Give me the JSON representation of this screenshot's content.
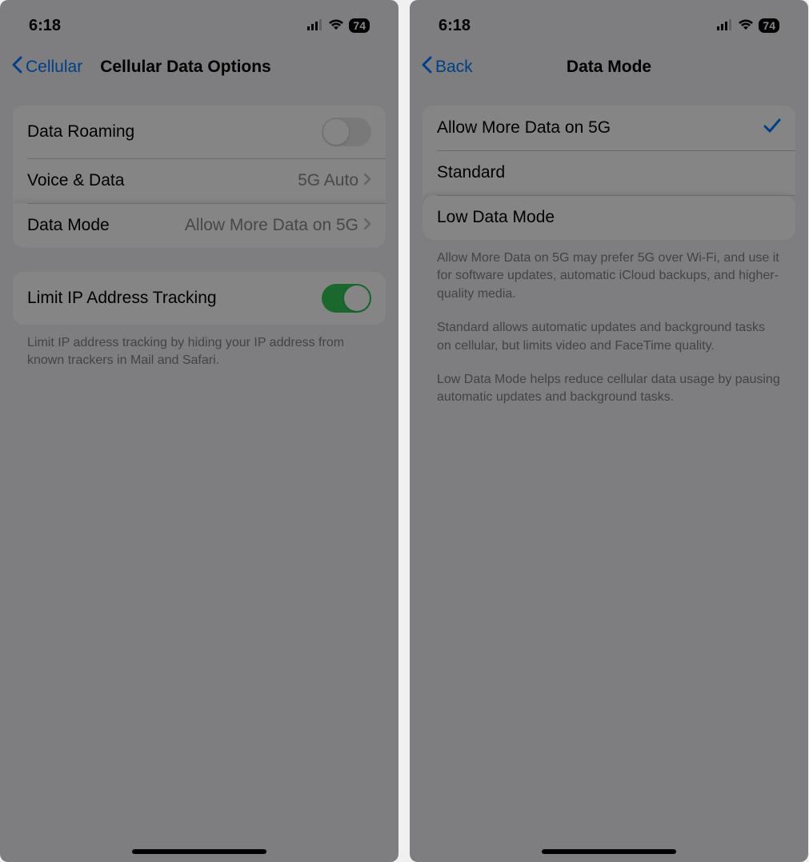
{
  "left": {
    "status_time": "6:18",
    "battery": "74",
    "back_label": "Cellular",
    "title": "Cellular Data Options",
    "rows": {
      "data_roaming": "Data Roaming",
      "voice_data": "Voice & Data",
      "voice_data_value": "5G Auto",
      "data_mode": "Data Mode",
      "data_mode_value": "Allow More Data on 5G",
      "limit_ip": "Limit IP Address Tracking"
    },
    "footer": "Limit IP address tracking by hiding your IP address from known trackers in Mail and Safari."
  },
  "right": {
    "status_time": "6:18",
    "battery": "74",
    "back_label": "Back",
    "title": "Data Mode",
    "options": {
      "allow_more": "Allow More Data on 5G",
      "standard": "Standard",
      "low_data": "Low Data Mode"
    },
    "footer1": "Allow More Data on 5G may prefer 5G over Wi-Fi, and use it for software updates, automatic iCloud backups, and higher-quality media.",
    "footer2": "Standard allows automatic updates and background tasks on cellular, but limits video and FaceTime quality.",
    "footer3": "Low Data Mode helps reduce cellular data usage by pausing automatic updates and background tasks."
  }
}
